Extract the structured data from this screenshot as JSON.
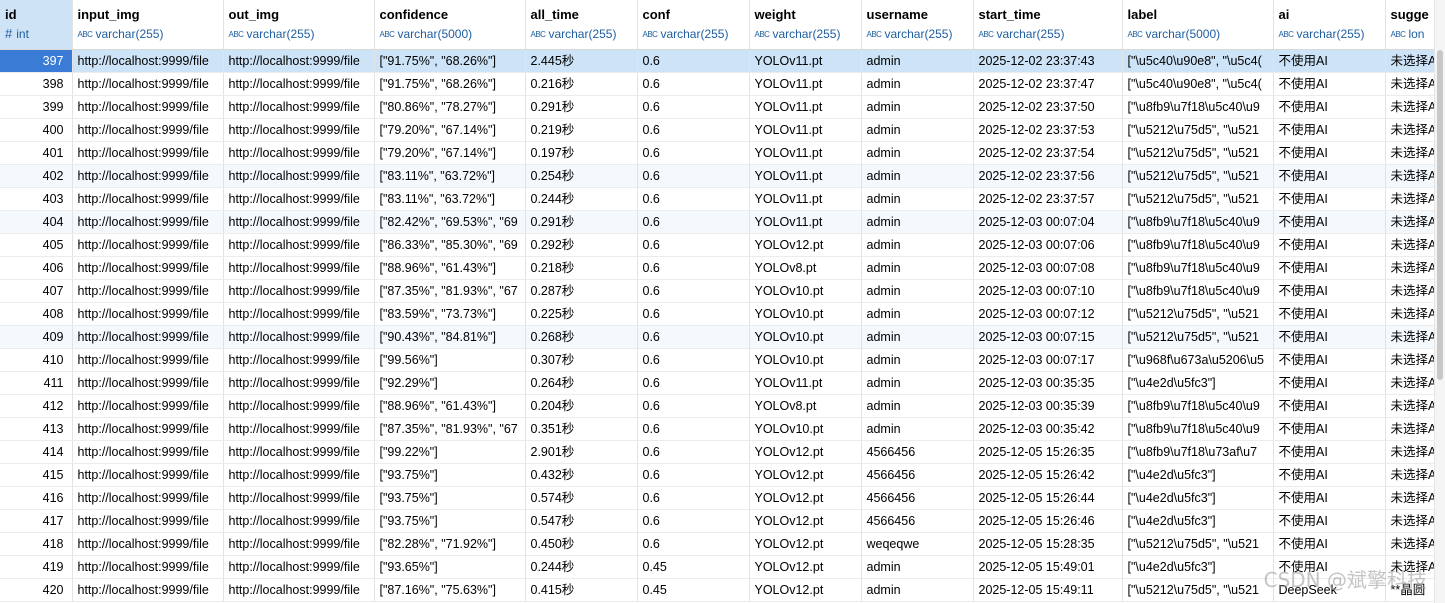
{
  "columns": [
    {
      "name": "id",
      "type": "int",
      "kind": "number"
    },
    {
      "name": "input_img",
      "type": "varchar(255)",
      "kind": "text"
    },
    {
      "name": "out_img",
      "type": "varchar(255)",
      "kind": "text"
    },
    {
      "name": "confidence",
      "type": "varchar(5000)",
      "kind": "text"
    },
    {
      "name": "all_time",
      "type": "varchar(255)",
      "kind": "text"
    },
    {
      "name": "conf",
      "type": "varchar(255)",
      "kind": "text"
    },
    {
      "name": "weight",
      "type": "varchar(255)",
      "kind": "text"
    },
    {
      "name": "username",
      "type": "varchar(255)",
      "kind": "text"
    },
    {
      "name": "start_time",
      "type": "varchar(255)",
      "kind": "text"
    },
    {
      "name": "label",
      "type": "varchar(5000)",
      "kind": "text"
    },
    {
      "name": "ai",
      "type": "varchar(255)",
      "kind": "text"
    },
    {
      "name": "sugge",
      "type": "lon",
      "kind": "text"
    }
  ],
  "rows": [
    [
      "397",
      "http://localhost:9999/file",
      "http://localhost:9999/file",
      "[\"91.75%\", \"68.26%\"]",
      "2.445秒",
      "0.6",
      "YOLOv11.pt",
      "admin",
      "2025-12-02 23:37:43",
      "[\"\\u5c40\\u90e8\", \"\\u5c4(",
      "不使用AI",
      "未选择A"
    ],
    [
      "398",
      "http://localhost:9999/file",
      "http://localhost:9999/file",
      "[\"91.75%\", \"68.26%\"]",
      "0.216秒",
      "0.6",
      "YOLOv11.pt",
      "admin",
      "2025-12-02 23:37:47",
      "[\"\\u5c40\\u90e8\", \"\\u5c4(",
      "不使用AI",
      "未选择A"
    ],
    [
      "399",
      "http://localhost:9999/file",
      "http://localhost:9999/file",
      "[\"80.86%\", \"78.27%\"]",
      "0.291秒",
      "0.6",
      "YOLOv11.pt",
      "admin",
      "2025-12-02 23:37:50",
      "[\"\\u8fb9\\u7f18\\u5c40\\u9",
      "不使用AI",
      "未选择A"
    ],
    [
      "400",
      "http://localhost:9999/file",
      "http://localhost:9999/file",
      "[\"79.20%\", \"67.14%\"]",
      "0.219秒",
      "0.6",
      "YOLOv11.pt",
      "admin",
      "2025-12-02 23:37:53",
      "[\"\\u5212\\u75d5\", \"\\u521",
      "不使用AI",
      "未选择A"
    ],
    [
      "401",
      "http://localhost:9999/file",
      "http://localhost:9999/file",
      "[\"79.20%\", \"67.14%\"]",
      "0.197秒",
      "0.6",
      "YOLOv11.pt",
      "admin",
      "2025-12-02 23:37:54",
      "[\"\\u5212\\u75d5\", \"\\u521",
      "不使用AI",
      "未选择A"
    ],
    [
      "402",
      "http://localhost:9999/file",
      "http://localhost:9999/file",
      "[\"83.11%\", \"63.72%\"]",
      "0.254秒",
      "0.6",
      "YOLOv11.pt",
      "admin",
      "2025-12-02 23:37:56",
      "[\"\\u5212\\u75d5\", \"\\u521",
      "不使用AI",
      "未选择A"
    ],
    [
      "403",
      "http://localhost:9999/file",
      "http://localhost:9999/file",
      "[\"83.11%\", \"63.72%\"]",
      "0.244秒",
      "0.6",
      "YOLOv11.pt",
      "admin",
      "2025-12-02 23:37:57",
      "[\"\\u5212\\u75d5\", \"\\u521",
      "不使用AI",
      "未选择A"
    ],
    [
      "404",
      "http://localhost:9999/file",
      "http://localhost:9999/file",
      "[\"82.42%\", \"69.53%\", \"69",
      "0.291秒",
      "0.6",
      "YOLOv11.pt",
      "admin",
      "2025-12-03 00:07:04",
      "[\"\\u8fb9\\u7f18\\u5c40\\u9",
      "不使用AI",
      "未选择A"
    ],
    [
      "405",
      "http://localhost:9999/file",
      "http://localhost:9999/file",
      "[\"86.33%\", \"85.30%\", \"69",
      "0.292秒",
      "0.6",
      "YOLOv12.pt",
      "admin",
      "2025-12-03 00:07:06",
      "[\"\\u8fb9\\u7f18\\u5c40\\u9",
      "不使用AI",
      "未选择A"
    ],
    [
      "406",
      "http://localhost:9999/file",
      "http://localhost:9999/file",
      "[\"88.96%\", \"61.43%\"]",
      "0.218秒",
      "0.6",
      "YOLOv8.pt",
      "admin",
      "2025-12-03 00:07:08",
      "[\"\\u8fb9\\u7f18\\u5c40\\u9",
      "不使用AI",
      "未选择A"
    ],
    [
      "407",
      "http://localhost:9999/file",
      "http://localhost:9999/file",
      "[\"87.35%\", \"81.93%\", \"67",
      "0.287秒",
      "0.6",
      "YOLOv10.pt",
      "admin",
      "2025-12-03 00:07:10",
      "[\"\\u8fb9\\u7f18\\u5c40\\u9",
      "不使用AI",
      "未选择A"
    ],
    [
      "408",
      "http://localhost:9999/file",
      "http://localhost:9999/file",
      "[\"83.59%\", \"73.73%\"]",
      "0.225秒",
      "0.6",
      "YOLOv10.pt",
      "admin",
      "2025-12-03 00:07:12",
      "[\"\\u5212\\u75d5\", \"\\u521",
      "不使用AI",
      "未选择A"
    ],
    [
      "409",
      "http://localhost:9999/file",
      "http://localhost:9999/file",
      "[\"90.43%\", \"84.81%\"]",
      "0.268秒",
      "0.6",
      "YOLOv10.pt",
      "admin",
      "2025-12-03 00:07:15",
      "[\"\\u5212\\u75d5\", \"\\u521",
      "不使用AI",
      "未选择A"
    ],
    [
      "410",
      "http://localhost:9999/file",
      "http://localhost:9999/file",
      "[\"99.56%\"]",
      "0.307秒",
      "0.6",
      "YOLOv10.pt",
      "admin",
      "2025-12-03 00:07:17",
      "[\"\\u968f\\u673a\\u5206\\u5",
      "不使用AI",
      "未选择A"
    ],
    [
      "411",
      "http://localhost:9999/file",
      "http://localhost:9999/file",
      "[\"92.29%\"]",
      "0.264秒",
      "0.6",
      "YOLOv11.pt",
      "admin",
      "2025-12-03 00:35:35",
      "[\"\\u4e2d\\u5fc3\"]",
      "不使用AI",
      "未选择A"
    ],
    [
      "412",
      "http://localhost:9999/file",
      "http://localhost:9999/file",
      "[\"88.96%\", \"61.43%\"]",
      "0.204秒",
      "0.6",
      "YOLOv8.pt",
      "admin",
      "2025-12-03 00:35:39",
      "[\"\\u8fb9\\u7f18\\u5c40\\u9",
      "不使用AI",
      "未选择A"
    ],
    [
      "413",
      "http://localhost:9999/file",
      "http://localhost:9999/file",
      "[\"87.35%\", \"81.93%\", \"67",
      "0.351秒",
      "0.6",
      "YOLOv10.pt",
      "admin",
      "2025-12-03 00:35:42",
      "[\"\\u8fb9\\u7f18\\u5c40\\u9",
      "不使用AI",
      "未选择A"
    ],
    [
      "414",
      "http://localhost:9999/file",
      "http://localhost:9999/file",
      "[\"99.22%\"]",
      "2.901秒",
      "0.6",
      "YOLOv12.pt",
      "4566456",
      "2025-12-05 15:26:35",
      "[\"\\u8fb9\\u7f18\\u73af\\u7",
      "不使用AI",
      "未选择A"
    ],
    [
      "415",
      "http://localhost:9999/file",
      "http://localhost:9999/file",
      "[\"93.75%\"]",
      "0.432秒",
      "0.6",
      "YOLOv12.pt",
      "4566456",
      "2025-12-05 15:26:42",
      "[\"\\u4e2d\\u5fc3\"]",
      "不使用AI",
      "未选择A"
    ],
    [
      "416",
      "http://localhost:9999/file",
      "http://localhost:9999/file",
      "[\"93.75%\"]",
      "0.574秒",
      "0.6",
      "YOLOv12.pt",
      "4566456",
      "2025-12-05 15:26:44",
      "[\"\\u4e2d\\u5fc3\"]",
      "不使用AI",
      "未选择A"
    ],
    [
      "417",
      "http://localhost:9999/file",
      "http://localhost:9999/file",
      "[\"93.75%\"]",
      "0.547秒",
      "0.6",
      "YOLOv12.pt",
      "4566456",
      "2025-12-05 15:26:46",
      "[\"\\u4e2d\\u5fc3\"]",
      "不使用AI",
      "未选择A"
    ],
    [
      "418",
      "http://localhost:9999/file",
      "http://localhost:9999/file",
      "[\"82.28%\", \"71.92%\"]",
      "0.450秒",
      "0.6",
      "YOLOv12.pt",
      "weqeqwe",
      "2025-12-05 15:28:35",
      "[\"\\u5212\\u75d5\", \"\\u521",
      "不使用AI",
      "未选择A"
    ],
    [
      "419",
      "http://localhost:9999/file",
      "http://localhost:9999/file",
      "[\"93.65%\"]",
      "0.244秒",
      "0.45",
      "YOLOv12.pt",
      "admin",
      "2025-12-05 15:49:01",
      "[\"\\u4e2d\\u5fc3\"]",
      "不使用AI",
      "未选择A"
    ],
    [
      "420",
      "http://localhost:9999/file",
      "http://localhost:9999/file",
      "[\"87.16%\", \"75.63%\"]",
      "0.415秒",
      "0.45",
      "YOLOv12.pt",
      "admin",
      "2025-12-05 15:49:11",
      "[\"\\u5212\\u75d5\", \"\\u521",
      "DeepSeek",
      "**晶圆"
    ]
  ],
  "selected_row": 0,
  "alt_rows": [
    5,
    7,
    12
  ],
  "watermark": "CSDN @斌擎科技",
  "colors": {
    "header_selected": "#cfe3f7",
    "row_selected": "#cde3f7",
    "id_selected": "#3a7bd5",
    "type_text": "#1f5fa0",
    "alt_row": "#f4f9fd"
  }
}
